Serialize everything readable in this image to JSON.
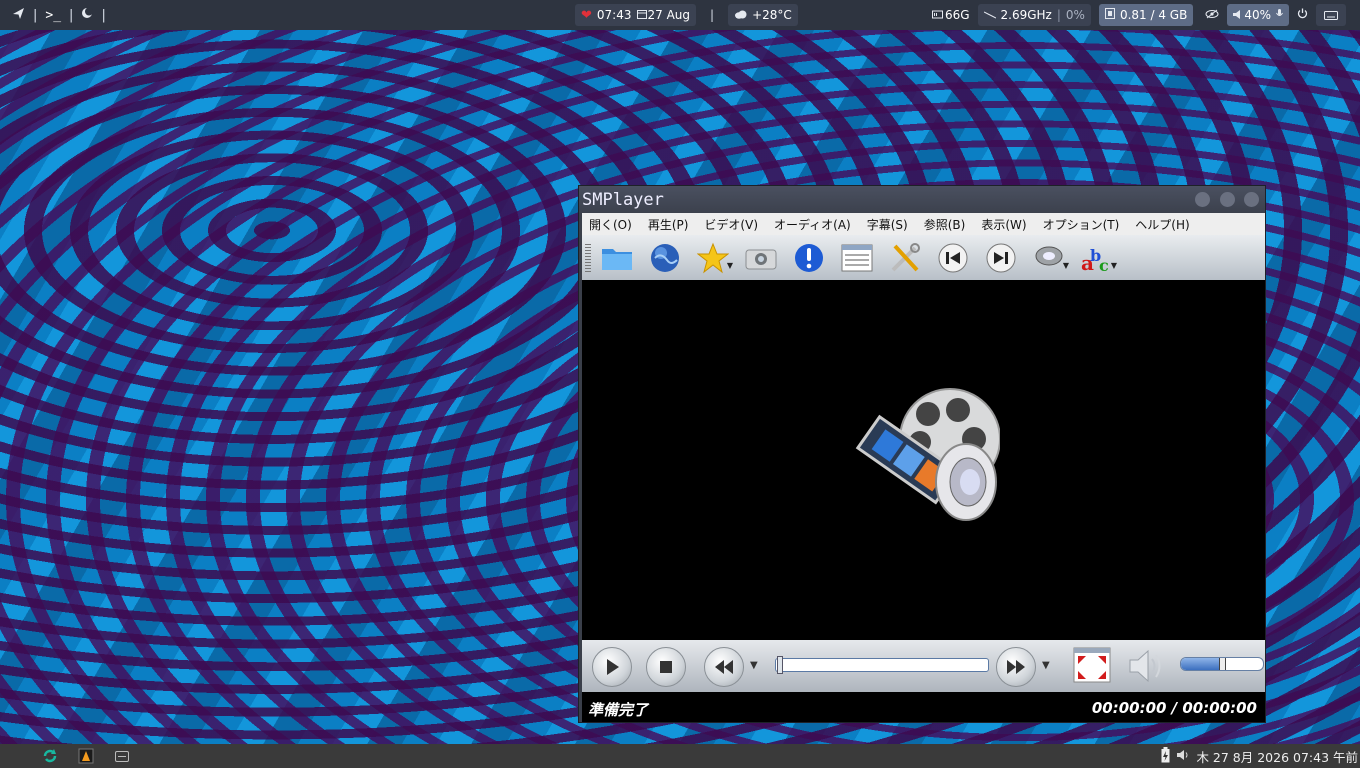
{
  "top_panel": {
    "left_items": [
      "|",
      "|",
      "|"
    ],
    "clock": "07:43",
    "date": "27 Aug",
    "center_sep": "|",
    "weather": "+28°C",
    "disk": "66G",
    "cpu_freq": "2.69GHz",
    "cpu_sep": "|",
    "cpu_load": "0%",
    "memory": "0.81 / 4 GB",
    "volume": "40%"
  },
  "window": {
    "title": "SMPlayer",
    "menu": [
      "開く(O)",
      "再生(P)",
      "ビデオ(V)",
      "オーディオ(A)",
      "字幕(S)",
      "参照(B)",
      "表示(W)",
      "オプション(T)",
      "ヘルプ(H)"
    ],
    "toolbar_icons": [
      "folder-icon",
      "globe-icon",
      "favorites-star-icon",
      "screenshot-camera-icon",
      "info-exclamation-icon",
      "playlist-icon",
      "preferences-tools-icon",
      "previous-track-icon",
      "next-track-icon",
      "audio-track-icon",
      "subtitle-abc-icon"
    ],
    "status_left": "準備完了",
    "status_time": "00:00:00 / 00:00:00",
    "seek_position": 0.0,
    "volume_level": 0.5
  },
  "bottom_panel": {
    "datetime": "木 27  8月 2026 07:43 午前"
  },
  "colors": {
    "panel_bg": "#2e3440",
    "heart": "#e0303a",
    "bottom_panel_bg": "#3a3a3a"
  }
}
